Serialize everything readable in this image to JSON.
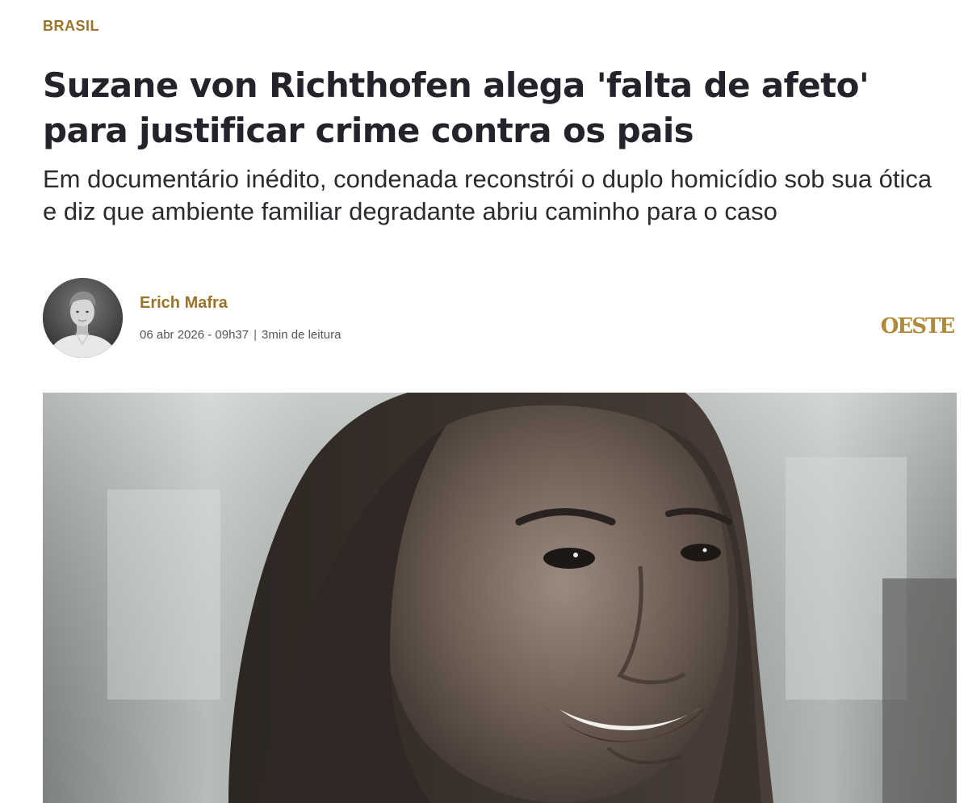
{
  "article": {
    "category": "BRASIL",
    "headline": "Suzane von Richthofen alega 'falta de afeto' para justificar crime contra os pais",
    "subtitle": "Em documentário inédito, condenada reconstrói o duplo homicídio sob sua ótica e diz que ambiente familiar degradante abriu caminho para o caso"
  },
  "byline": {
    "author": "Erich Mafra",
    "date": "06 abr 2026 - 09h37",
    "separator": "|",
    "read_time": "3min de leitura"
  },
  "brand": {
    "logo_text": "OESTE",
    "accent_color": "#9a7428"
  },
  "hero_image": {
    "icon": "photo-woman-smiling"
  }
}
